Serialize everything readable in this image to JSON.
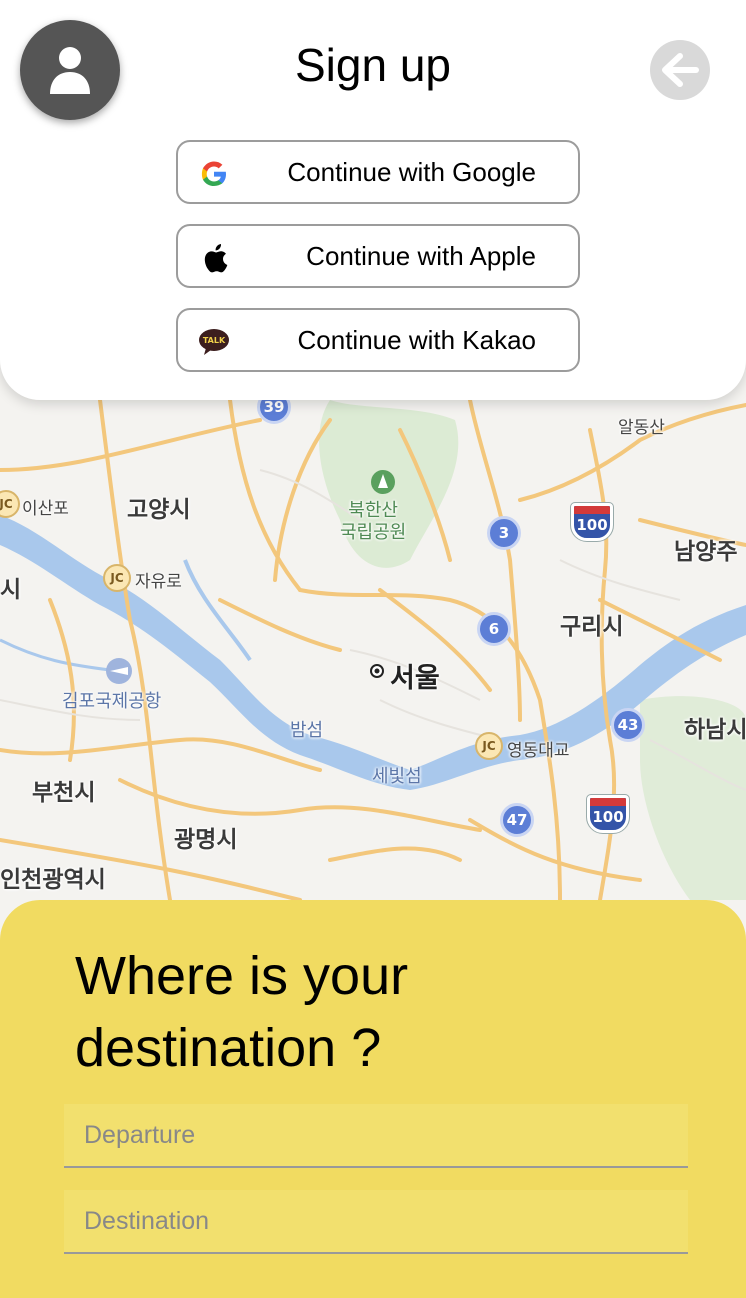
{
  "header": {
    "title": "Sign up",
    "avatar_icon": "user-icon",
    "back_icon": "arrow-left-icon"
  },
  "auth_buttons": [
    {
      "label": "Continue with Google",
      "icon": "google-logo-icon"
    },
    {
      "label": "Continue with Apple",
      "icon": "apple-logo-icon"
    },
    {
      "label": "Continue with Kakao",
      "icon": "kakao-talk-icon"
    }
  ],
  "map": {
    "labels": {
      "알동산": "알동산",
      "ilsanpo": "이산포",
      "goyang": "고양시",
      "bukhansan": "북한산\n국립공원",
      "namyangju": "남양주",
      "si_left": "시",
      "jayuro": "자유로",
      "guri": "구리시",
      "seoul": "서울",
      "gimpo_airport": "김포국제공항",
      "bamseom": "밤섬",
      "hanam": "하남시",
      "yeongdong": "영동대교",
      "sebitseom": "세빛섬",
      "bucheon": "부천시",
      "gwangmyeong": "광명시",
      "incheon": "인천광역시"
    },
    "route_shields": [
      "39",
      "3",
      "6",
      "43",
      "47"
    ],
    "us_shields": [
      "100",
      "100"
    ],
    "junction_mark": "JC"
  },
  "destination": {
    "heading": "Where is your destination ?",
    "departure_placeholder": "Departure",
    "destination_placeholder": "Destination",
    "departure_value": "",
    "destination_value": ""
  },
  "colors": {
    "card_yellow": "#f1db61",
    "avatar_gray": "#555555",
    "back_gray": "#d9d9d9",
    "kakao_brown": "#3c1e1e"
  }
}
